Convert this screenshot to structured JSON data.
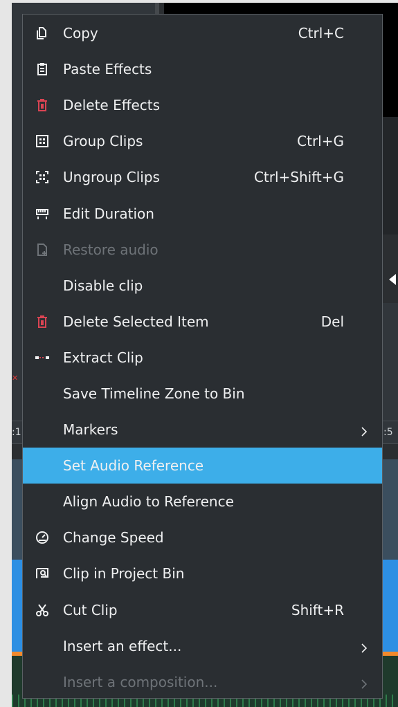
{
  "background": {
    "ruler_left": ":1",
    "ruler_right": ":5"
  },
  "menu": {
    "items": [
      {
        "label": "Copy",
        "shortcut": "Ctrl+C",
        "icon": "copy-icon"
      },
      {
        "label": "Paste Effects",
        "shortcut": "",
        "icon": "paste-icon"
      },
      {
        "label": "Delete Effects",
        "shortcut": "",
        "icon": "trash-icon"
      },
      {
        "label": "Group Clips",
        "shortcut": "Ctrl+G",
        "icon": "group-icon"
      },
      {
        "label": "Ungroup Clips",
        "shortcut": "Ctrl+Shift+G",
        "icon": "ungroup-icon"
      },
      {
        "label": "Edit Duration",
        "shortcut": "",
        "icon": "duration-icon"
      },
      {
        "label": "Restore audio",
        "shortcut": "",
        "icon": "restore-audio-icon",
        "disabled": true
      },
      {
        "label": "Disable clip",
        "shortcut": ""
      },
      {
        "label": "Delete Selected Item",
        "shortcut": "Del",
        "icon": "trash-icon"
      },
      {
        "label": "Extract Clip",
        "shortcut": "",
        "icon": "extract-icon"
      },
      {
        "label": "Save Timeline Zone to Bin",
        "shortcut": ""
      },
      {
        "label": "Markers",
        "shortcut": "",
        "submenu": true
      },
      {
        "label": "Set Audio Reference",
        "shortcut": "",
        "highlighted": true
      },
      {
        "label": "Align Audio to Reference",
        "shortcut": ""
      },
      {
        "label": "Change Speed",
        "shortcut": "",
        "icon": "speedometer-icon"
      },
      {
        "label": "Clip in Project Bin",
        "shortcut": "",
        "icon": "find-in-bin-icon"
      },
      {
        "label": "Cut Clip",
        "shortcut": "Shift+R",
        "icon": "scissors-icon"
      },
      {
        "label": "Insert an effect...",
        "shortcut": "",
        "submenu": true
      },
      {
        "label": "Insert a composition...",
        "shortcut": "",
        "submenu": true,
        "disabled": true
      }
    ]
  },
  "colors": {
    "menu_bg": "#2a2e32",
    "highlight": "#3daee9",
    "text": "#eff0f1",
    "disabled_text": "#6e7378",
    "delete_icon": "#da4453"
  }
}
